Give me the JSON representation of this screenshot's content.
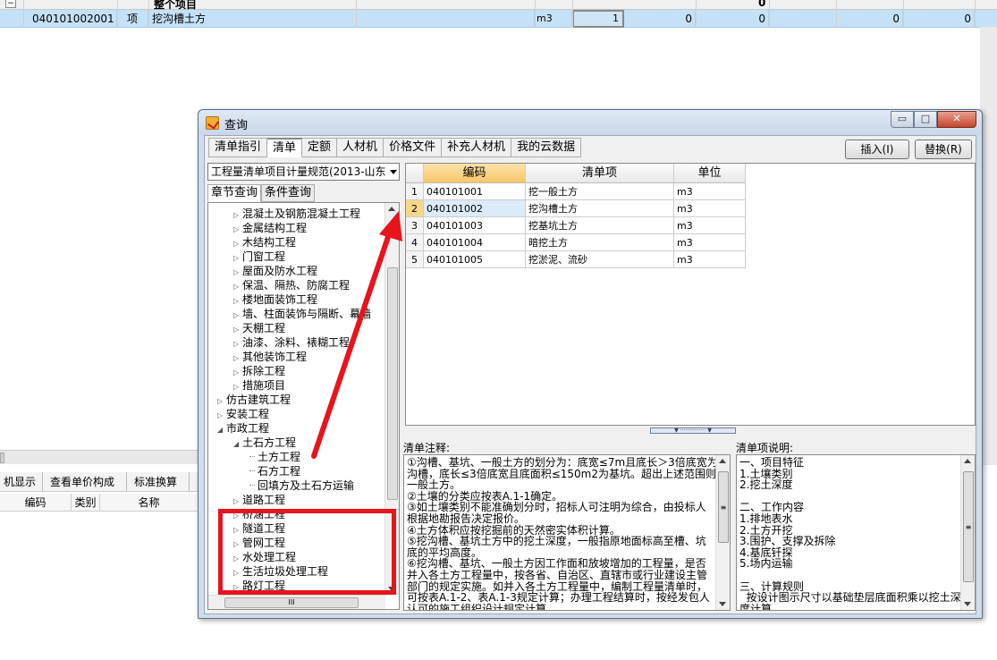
{
  "background": {
    "row0_title": "整个项目",
    "row0_total": "0",
    "row1": {
      "code": "040101002001",
      "type": "项",
      "name": "挖沟槽土方",
      "unit": "m3",
      "qty": "1",
      "c1": "0",
      "c2": "0",
      "c3": "0",
      "c4": "0"
    },
    "bottom_tabs": [
      "机显示",
      "查看单价构成",
      "标准换算"
    ],
    "bottom_headers": [
      "编码",
      "类别",
      "名称"
    ]
  },
  "dialog": {
    "title": "查询",
    "window_buttons": {
      "minimize": "▭",
      "maximize": "□",
      "close": "✕"
    },
    "tabs": [
      "清单指引",
      "清单",
      "定额",
      "人材机",
      "价格文件",
      "补充人材机",
      "我的云数据"
    ],
    "active_tab": "清单",
    "insert_button": "插入(I)",
    "replace_button": "替换(R)",
    "spec_combo": "工程量清单项目计量规范(2013-山东",
    "subtabs": [
      "章节查询",
      "条件查询"
    ],
    "tree": [
      {
        "label": "混凝土及钢筋混凝土工程",
        "exp": "▷"
      },
      {
        "label": "金属结构工程",
        "exp": "▷"
      },
      {
        "label": "木结构工程",
        "exp": "▷"
      },
      {
        "label": "门窗工程",
        "exp": "▷"
      },
      {
        "label": "屋面及防水工程",
        "exp": "▷"
      },
      {
        "label": "保温、隔热、防腐工程",
        "exp": "▷"
      },
      {
        "label": "楼地面装饰工程",
        "exp": "▷"
      },
      {
        "label": "墙、柱面装饰与隔断、幕墙",
        "exp": "▷"
      },
      {
        "label": "天棚工程",
        "exp": "▷"
      },
      {
        "label": "油漆、涂料、裱糊工程",
        "exp": "▷"
      },
      {
        "label": "其他装饰工程",
        "exp": "▷"
      },
      {
        "label": "拆除工程",
        "exp": "▷"
      },
      {
        "label": "措施项目",
        "exp": "▷"
      },
      {
        "label": "仿古建筑工程",
        "exp": "▷"
      },
      {
        "label": "安装工程",
        "exp": "▷"
      },
      {
        "label": "市政工程",
        "exp": "◢"
      },
      {
        "label": "土石方工程",
        "exp": "◢"
      },
      {
        "label": "土方工程",
        "exp": ""
      },
      {
        "label": "石方工程",
        "exp": ""
      },
      {
        "label": "回填方及土石方运输",
        "exp": ""
      },
      {
        "label": "道路工程",
        "exp": "▷"
      },
      {
        "label": "桥涵工程",
        "exp": "▷"
      },
      {
        "label": "隧道工程",
        "exp": "▷"
      },
      {
        "label": "管网工程",
        "exp": "▷"
      },
      {
        "label": "水处理工程",
        "exp": "▷"
      },
      {
        "label": "生活垃圾处理工程",
        "exp": "▷"
      },
      {
        "label": "路灯工程",
        "exp": "▷"
      }
    ],
    "grid": {
      "headers": [
        "编码",
        "清单项",
        "单位"
      ],
      "rows": [
        {
          "num": "1",
          "code": "040101001",
          "name": "挖一般土方",
          "unit": "m3"
        },
        {
          "num": "2",
          "code": "040101002",
          "name": "挖沟槽土方",
          "unit": "m3"
        },
        {
          "num": "3",
          "code": "040101003",
          "name": "挖基坑土方",
          "unit": "m3"
        },
        {
          "num": "4",
          "code": "040101004",
          "name": "暗挖土方",
          "unit": "m3"
        },
        {
          "num": "5",
          "code": "040101005",
          "name": "挖淤泥、流砂",
          "unit": "m3"
        }
      ],
      "selected_row": 2
    },
    "notes_label": "清单注释:",
    "notes_text": "①沟槽、基坑、一般土方的划分为：底宽≤7m且底长＞3倍底宽为\n沟槽，底长≤3倍底宽且底面积≤150m2为基坑。超出上述范围则为\n一般土方。\n②土壤的分类应按表A.1-1确定。\n③如土壤类别不能准确划分时，招标人可注明为综合，由投标人\n根据地勘报告决定报价。\n④土方体积应按挖掘前的天然密实体积计算。\n⑤挖沟槽、基坑土方中的挖土深度，一般指原地面标高至槽、坑\n底的平均高度。\n⑥挖沟槽、基坑、一般土方因工作面和放坡增加的工程量，是否\n并入各土方工程量中，按各省、自治区、直辖市或行业建设主管\n部门的规定实施。如并入各土方工程量中，编制工程量清单时，\n可按表A.1-2、表A.1-3规定计算；办理工程结算时，按经发包人\n认可的施工组织设计规定计算。",
    "desc_label": "清单项说明:",
    "desc_text": "一、项目特征\n1.土壤类别\n2.挖土深度\n\n二、工作内容\n1.排地表水\n2.土方开挖\n3.围护、支撑及拆除\n4.基底钎探\n5.场内运输\n\n三、计算规则\n  按设计图示尺寸以基础垫层底面积乘以挖土深\n度计算"
  },
  "colors": {
    "highlight_red": "#e8131c",
    "selected_row_blue": "#c5e1f7",
    "header_orange": "#f7c66a"
  }
}
